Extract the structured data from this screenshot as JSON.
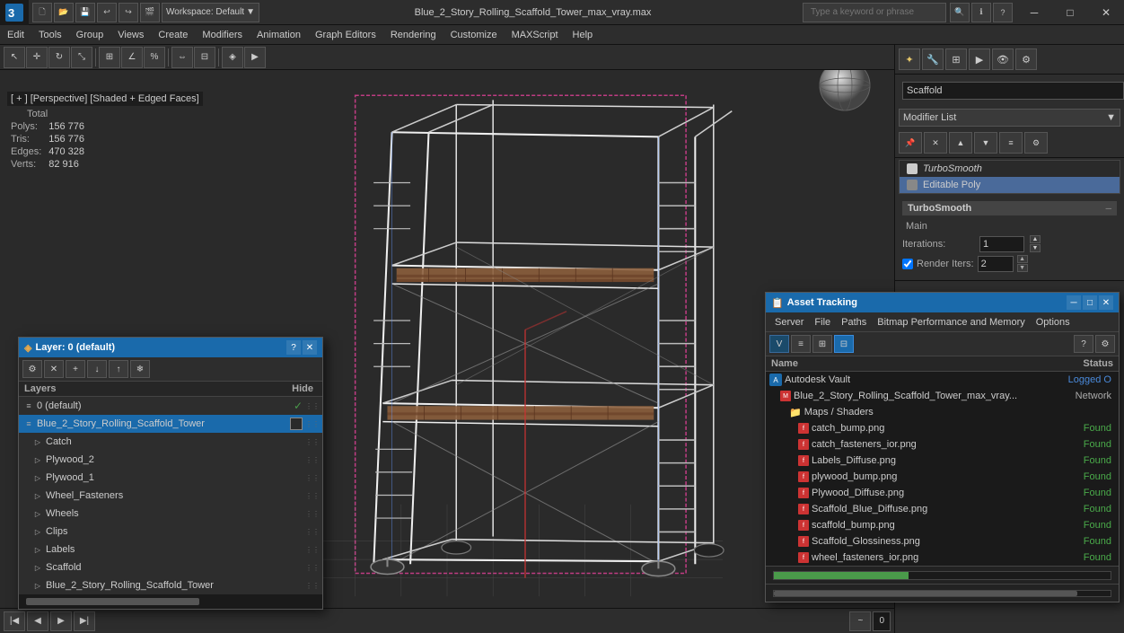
{
  "titlebar": {
    "app_name": "3ds Max",
    "workspace": "Workspace: Default",
    "file_title": "Blue_2_Story_Rolling_Scaffold_Tower_max_vray.max",
    "search_placeholder": "Type a keyword or phrase",
    "minimize": "─",
    "maximize": "□",
    "close": "✕"
  },
  "menubar": {
    "items": [
      "Edit",
      "Tools",
      "Group",
      "Views",
      "Create",
      "Modifiers",
      "Animation",
      "Graph Editors",
      "Rendering",
      "Customize",
      "MAXScript",
      "Help"
    ]
  },
  "viewport": {
    "label": "[ + ] [Perspective] [Shaded + Edged Faces]",
    "bg_color": "#222222"
  },
  "stats": {
    "total_label": "Total",
    "polys_label": "Polys:",
    "polys_value": "156 776",
    "tris_label": "Tris:",
    "tris_value": "156 776",
    "edges_label": "Edges:",
    "edges_value": "470 328",
    "verts_label": "Verts:",
    "verts_value": "82 916"
  },
  "right_panel": {
    "object_name": "Scaffold",
    "modifier_list_label": "Modifier List",
    "modifiers": [
      {
        "name": "TurboSmooth",
        "type": "turbosmooth"
      },
      {
        "name": "Editable Poly",
        "type": "editpoly"
      }
    ],
    "turbosmooth": {
      "title": "TurboSmooth",
      "main_label": "Main",
      "iterations_label": "Iterations:",
      "iterations_value": "1",
      "render_iters_label": "Render Iters:",
      "render_iters_value": "2",
      "checkbox_label": "Render Iters"
    }
  },
  "layers_window": {
    "title": "Layer: 0 (default)",
    "close_btn": "✕",
    "question_btn": "?",
    "columns": {
      "layers": "Layers",
      "hide": "Hide"
    },
    "items": [
      {
        "name": "0 (default)",
        "indent": 0,
        "checked": true,
        "type": "layer"
      },
      {
        "name": "Blue_2_Story_Rolling_Scaffold_Tower",
        "indent": 0,
        "selected": true,
        "type": "layer"
      },
      {
        "name": "Catch",
        "indent": 1,
        "type": "object"
      },
      {
        "name": "Plywood_2",
        "indent": 1,
        "type": "object"
      },
      {
        "name": "Plywood_1",
        "indent": 1,
        "type": "object"
      },
      {
        "name": "Wheel_Fasteners",
        "indent": 1,
        "type": "object"
      },
      {
        "name": "Wheels",
        "indent": 1,
        "type": "object"
      },
      {
        "name": "Clips",
        "indent": 1,
        "type": "object"
      },
      {
        "name": "Labels",
        "indent": 1,
        "type": "object"
      },
      {
        "name": "Scaffold",
        "indent": 1,
        "type": "object"
      },
      {
        "name": "Blue_2_Story_Rolling_Scaffold_Tower",
        "indent": 1,
        "type": "object"
      }
    ]
  },
  "asset_window": {
    "title": "Asset Tracking",
    "close_btn": "✕",
    "minimize_btn": "─",
    "maximize_btn": "□",
    "menu": [
      "Server",
      "File",
      "Paths",
      "Bitmap Performance and Memory",
      "Options"
    ],
    "columns": {
      "name": "Name",
      "status": "Status"
    },
    "items": [
      {
        "name": "Autodesk Vault",
        "status": "Logged O",
        "type": "vault",
        "indent": 0
      },
      {
        "name": "Blue_2_Story_Rolling_Scaffold_Tower_max_vray...",
        "status": "Network",
        "type": "file_main",
        "indent": 1
      },
      {
        "name": "Maps / Shaders",
        "status": "",
        "type": "folder",
        "indent": 2
      },
      {
        "name": "catch_bump.png",
        "status": "Found",
        "type": "file",
        "indent": 3
      },
      {
        "name": "catch_fasteners_ior.png",
        "status": "Found",
        "type": "file",
        "indent": 3
      },
      {
        "name": "Labels_Diffuse.png",
        "status": "Found",
        "type": "file",
        "indent": 3
      },
      {
        "name": "plywood_bump.png",
        "status": "Found",
        "type": "file",
        "indent": 3
      },
      {
        "name": "Plywood_Diffuse.png",
        "status": "Found",
        "type": "file",
        "indent": 3
      },
      {
        "name": "Scaffold_Blue_Diffuse.png",
        "status": "Found",
        "type": "file",
        "indent": 3
      },
      {
        "name": "scaffold_bump.png",
        "status": "Found",
        "type": "file",
        "indent": 3
      },
      {
        "name": "Scaffold_Glossiness.png",
        "status": "Found",
        "type": "file",
        "indent": 3
      },
      {
        "name": "wheel_fasteners_ior.png",
        "status": "Found",
        "type": "file",
        "indent": 3
      }
    ]
  }
}
